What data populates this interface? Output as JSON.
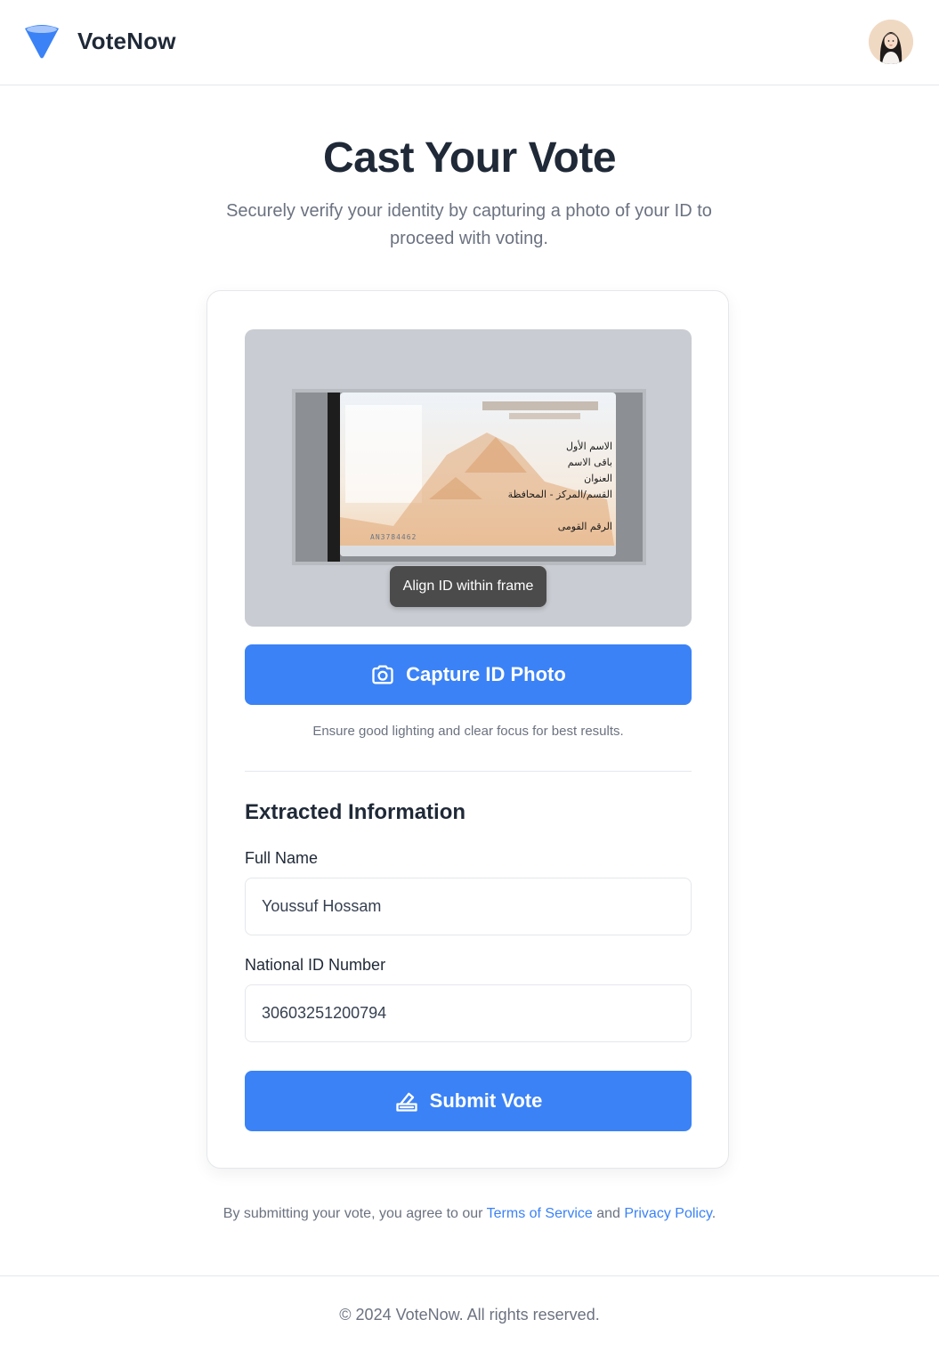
{
  "header": {
    "brand": "VoteNow",
    "logo_icon": "funnel-logo-icon",
    "avatar_icon": "user-avatar"
  },
  "main": {
    "title": "Cast Your Vote",
    "subtitle": "Securely verify your identity by capturing a photo of your ID to proceed with voting."
  },
  "card": {
    "preview_hint": "Align ID within frame",
    "capture_label": "Capture ID Photo",
    "capture_icon": "camera-icon",
    "lighting_hint": "Ensure good lighting and clear focus for best results.",
    "section_title": "Extracted Information",
    "full_name_label": "Full Name",
    "full_name_value": "Youssuf Hossam",
    "national_id_label": "National ID Number",
    "national_id_value": "30603251200794",
    "submit_label": "Submit Vote",
    "submit_icon": "ballot-icon"
  },
  "id_card": {
    "lines": [
      "الاسم الأول",
      "باقى الاسم",
      "العنوان",
      "القسم/المركز - المحافظة",
      "الرقم القومى"
    ],
    "serial": "AN3784462"
  },
  "legal": {
    "prefix": "By submitting your vote, you agree to our ",
    "terms": "Terms of Service",
    "middle": " and ",
    "privacy": "Privacy Policy",
    "suffix": "."
  },
  "footer": {
    "copyright": "© 2024 VoteNow. All rights reserved."
  },
  "colors": {
    "accent": "#3b82f6",
    "text": "#1f2937",
    "muted": "#6b7280"
  }
}
